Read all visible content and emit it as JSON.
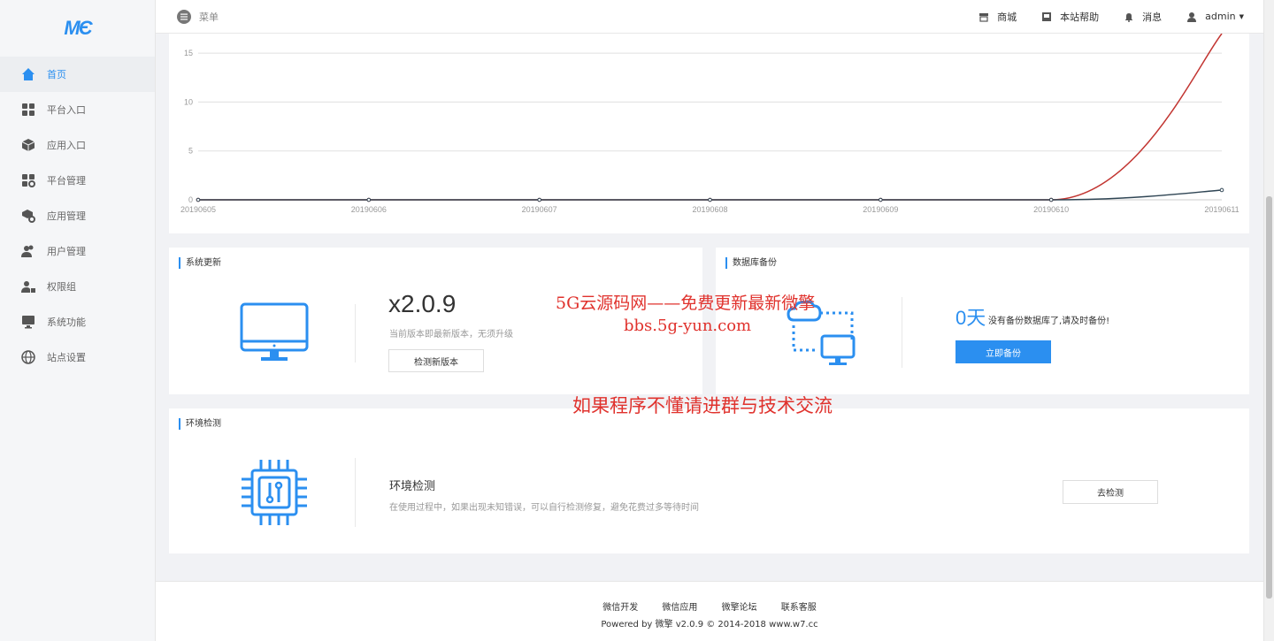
{
  "logo": "MЄ",
  "sidebar": {
    "items": [
      {
        "label": "首页",
        "icon": "home-icon",
        "active": true
      },
      {
        "label": "平台入口",
        "icon": "grid-icon"
      },
      {
        "label": "应用入口",
        "icon": "cube-icon"
      },
      {
        "label": "平台管理",
        "icon": "grid-gear-icon"
      },
      {
        "label": "应用管理",
        "icon": "cube-gear-icon"
      },
      {
        "label": "用户管理",
        "icon": "users-icon"
      },
      {
        "label": "权限组",
        "icon": "user-lock-icon"
      },
      {
        "label": "系统功能",
        "icon": "monitor-icon"
      },
      {
        "label": "站点设置",
        "icon": "globe-icon"
      }
    ]
  },
  "header": {
    "menu_label": "菜单",
    "links": [
      {
        "label": "商城",
        "icon": "shop-icon"
      },
      {
        "label": "本站帮助",
        "icon": "help-icon"
      },
      {
        "label": "消息",
        "icon": "bell-icon"
      },
      {
        "label": "admin",
        "icon": "user-icon"
      }
    ]
  },
  "chart_data": {
    "type": "line",
    "x": [
      "20190605",
      "20190606",
      "20190607",
      "20190608",
      "20190609",
      "20190610",
      "20190611"
    ],
    "y_ticks": [
      0,
      5,
      10,
      15
    ],
    "ylim": [
      0,
      17
    ],
    "grid": true,
    "series": [
      {
        "values": [
          0,
          0,
          0,
          0,
          0,
          0,
          17
        ],
        "color": "#c23531"
      },
      {
        "values": [
          0,
          0,
          0,
          0,
          0,
          0,
          1
        ],
        "color": "#2f4554"
      }
    ]
  },
  "update": {
    "title": "系统更新",
    "version": "x2.0.9",
    "note": "当前版本即最新版本，无须升级",
    "button": "检测新版本"
  },
  "backup": {
    "title": "数据库备份",
    "days": "0天",
    "note": "没有备份数据库了,请及时备份!",
    "button": "立即备份"
  },
  "env": {
    "section_title": "环境检测",
    "title": "环境检测",
    "desc": "在使用过程中，如果出现未知错误，可以自行检测修复，避免花费过多等待时间",
    "button": "去检测"
  },
  "footer": {
    "links": [
      "微信开发",
      "微信应用",
      "微擎论坛",
      "联系客服"
    ],
    "powered": "Powered by 微擎 v2.0.9 © 2014-2018 www.w7.cc"
  },
  "watermark": {
    "line1": "5G云源码网——免费更新最新微擎",
    "line2": "bbs.5g-yun.com",
    "line3": "如果程序不懂请进群与技术交流"
  },
  "colors": {
    "accent": "#2b8ff0",
    "watermark": "#e0322d"
  }
}
